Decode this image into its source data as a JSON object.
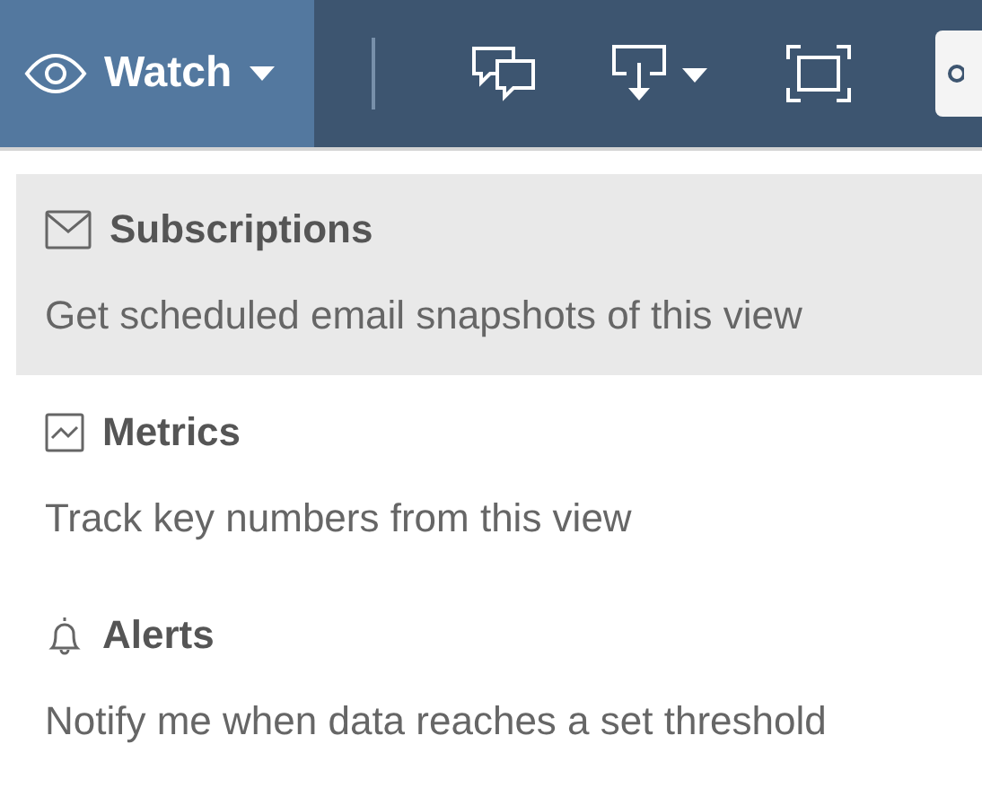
{
  "toolbar": {
    "watch_button": {
      "label": "Watch",
      "expanded": true
    }
  },
  "menu": {
    "items": [
      {
        "kind": "subscriptions",
        "title": "Subscriptions",
        "description": "Get scheduled email snapshots of this view",
        "selected": true
      },
      {
        "kind": "metrics",
        "title": "Metrics",
        "description": "Track key numbers from this view",
        "selected": false
      },
      {
        "kind": "alerts",
        "title": "Alerts",
        "description": "Notify me when data reaches a set threshold",
        "selected": false
      }
    ]
  }
}
